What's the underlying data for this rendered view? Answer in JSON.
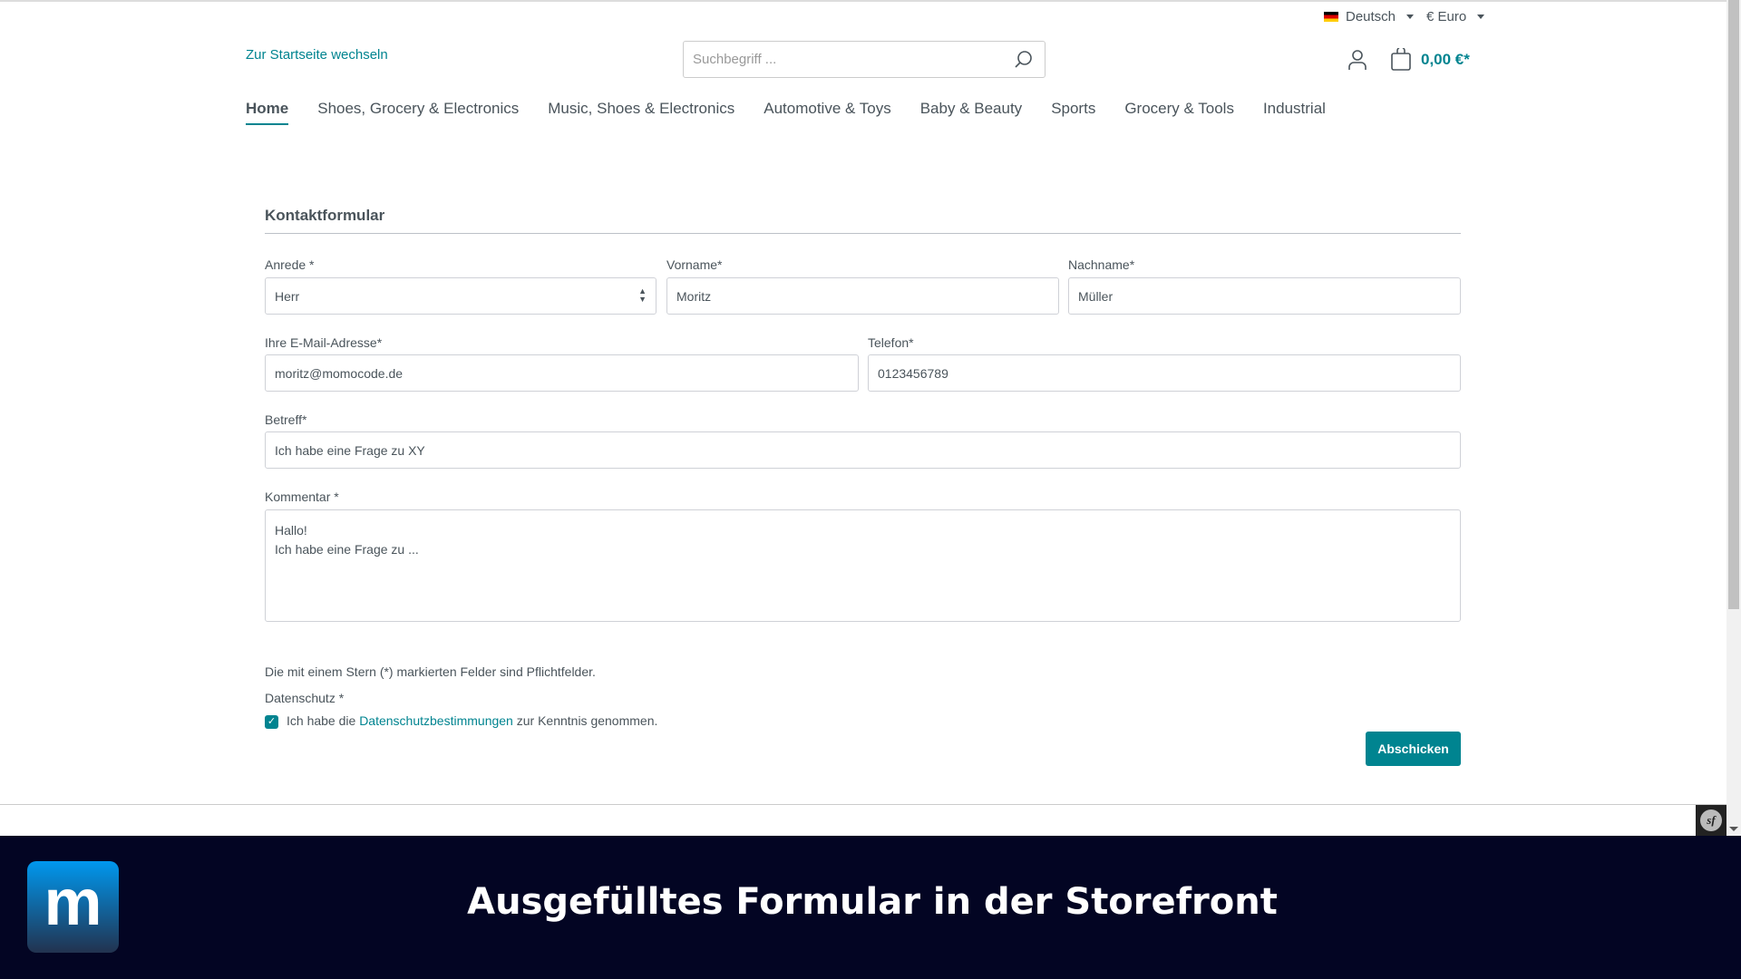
{
  "topbar": {
    "language": "Deutsch",
    "currency": "€ Euro"
  },
  "header": {
    "logo_alt": "Zur Startseite wechseln",
    "search_placeholder": "Suchbegriff ...",
    "cart_total": "0,00 €*"
  },
  "nav": [
    "Home",
    "Shoes, Grocery & Electronics",
    "Music, Shoes & Electronics",
    "Automotive & Toys",
    "Baby & Beauty",
    "Sports",
    "Grocery & Tools",
    "Industrial"
  ],
  "form": {
    "title": "Kontaktformular",
    "salutation": {
      "label": "Anrede *",
      "value": "Herr"
    },
    "firstname": {
      "label": "Vorname*",
      "value": "Moritz"
    },
    "lastname": {
      "label": "Nachname*",
      "value": "Müller"
    },
    "email": {
      "label": "Ihre E-Mail-Adresse*",
      "value": "moritz@momocode.de"
    },
    "phone": {
      "label": "Telefon*",
      "value": "0123456789"
    },
    "subject": {
      "label": "Betreff*",
      "value": "Ich habe eine Frage zu XY"
    },
    "comment": {
      "label": "Kommentar *",
      "line1": "Hallo!",
      "line2": "Ich habe eine Frage zu ..."
    },
    "required_note": "Die mit einem Stern (*) markierten Felder sind Pflichtfelder.",
    "privacy": {
      "label": "Datenschutz *",
      "text_before": "Ich habe die",
      "link": "Datenschutzbestimmungen",
      "text_after": "zur Kenntnis genommen.",
      "checked": true
    },
    "submit": "Abschicken"
  },
  "banner": {
    "logo_letter": "m",
    "title": "Ausgefülltes Formular in der Storefront"
  },
  "colors": {
    "accent": "#008490",
    "banner": "#030523"
  }
}
